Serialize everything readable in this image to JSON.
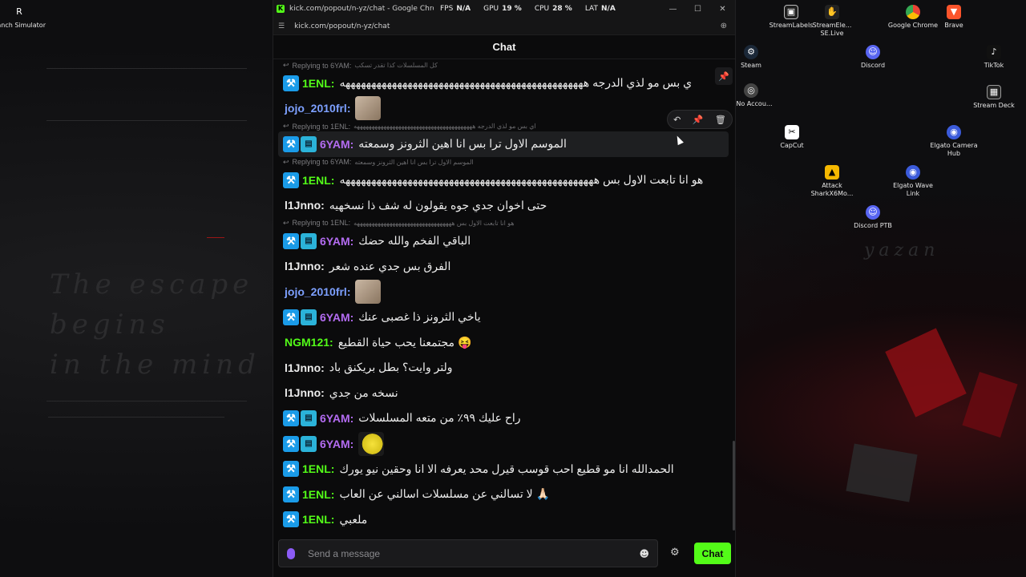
{
  "desktop": {
    "watermark_lines": [
      "The escape",
      "begins",
      "in the mind"
    ],
    "signature": "yazan",
    "icons": [
      {
        "label": "Ranch Simulator",
        "icon": "ranch-icon",
        "color": "#ffffff"
      },
      {
        "label": "StreamLabels",
        "icon": "streamlabels-icon",
        "color": "#ffffff"
      },
      {
        "label": "StreamEle... SE.Live",
        "icon": "streamelements-icon",
        "color": "#ffffff"
      },
      {
        "label": "Google Chrome",
        "icon": "chrome-icon",
        "color": "#4285f4"
      },
      {
        "label": "Brave",
        "icon": "brave-icon",
        "color": "#fb542b"
      },
      {
        "label": "Steam",
        "icon": "steam-icon",
        "color": "#1b2838"
      },
      {
        "label": "Discord",
        "icon": "discord-icon",
        "color": "#5865f2"
      },
      {
        "label": "TikTok",
        "icon": "tiktok-icon",
        "color": "#111111"
      },
      {
        "label": "TcNo Accou...",
        "icon": "tcno-icon",
        "color": "#444444"
      },
      {
        "label": "Stream Deck",
        "icon": "streamdeck-icon",
        "color": "#222222"
      },
      {
        "label": "CapCut",
        "icon": "capcut-icon",
        "color": "#ffffff"
      },
      {
        "label": "Elgato Camera Hub",
        "icon": "elgato-camera-icon",
        "color": "#3b5bdb"
      },
      {
        "label": "Attack SharkX6Mo...",
        "icon": "attackshark-icon",
        "color": "#f5b800"
      },
      {
        "label": "Elgato Wave Link",
        "icon": "elgato-wave-icon",
        "color": "#3b5bdb"
      },
      {
        "label": "Discord PTB",
        "icon": "discord-ptb-icon",
        "color": "#5865f2"
      }
    ]
  },
  "window": {
    "title": "kick.com/popout/n-yz/chat - Google Chrome",
    "url": "kick.com/popout/n-yz/chat",
    "stats": [
      {
        "label": "FPS",
        "value": "N/A"
      },
      {
        "label": "GPU",
        "value": "19 %"
      },
      {
        "label": "CPU",
        "value": "28 %"
      },
      {
        "label": "LAT",
        "value": "N/A"
      }
    ],
    "controls": {
      "minimize": "—",
      "maximize": "☐",
      "close": "✕"
    }
  },
  "chat": {
    "header": "Chat",
    "messages": [
      {
        "reply_to": "Replying to 6YAM:",
        "reply_text": "كل المسلسلات كذا تقدر تسكب"
      },
      {
        "user": "1ENL",
        "user_color": "#53fc18",
        "badges": [
          "mod"
        ],
        "text": "ي بس مو لذي الدرجه هههههههههههههههههههههههههههههههههههههههههههههههه"
      },
      {
        "user": "jojo_2010frl",
        "user_color": "#7da0ff",
        "badges": [],
        "emote": "baby-emote"
      },
      {
        "reply_to": "Replying to 1ENL:",
        "reply_text": "اي بس مو لذي الدرجه ههههههههههههههههههههههههههههههههههههههههه"
      },
      {
        "user": "6YAM",
        "user_color": "#b46cf2",
        "badges": [
          "mod",
          "sub"
        ],
        "text": "الموسم الاول ترا بس انا اهين الثرونز وسمعته",
        "highlight": true
      },
      {
        "reply_to": "Replying to 6YAM:",
        "reply_text": "الموسم الاول ترا بس انا اهين الثرونز وسمعته"
      },
      {
        "user": "1ENL",
        "user_color": "#53fc18",
        "badges": [
          "mod"
        ],
        "text": "هو انا تابعت الاول بس هههههههههههههههههههههههههههههههههههههههههههههههههه"
      },
      {
        "user": "l1Jnno",
        "user_color": "#ececec",
        "badges": [],
        "text": "حتى اخوان جدي جوه يقولون له شف ذا نسخهيه"
      },
      {
        "reply_to": "Replying to 1ENL:",
        "reply_text": "هو انا تابعت الاول بس هههههههههههههههههههههههههههههههههه"
      },
      {
        "user": "6YAM",
        "user_color": "#b46cf2",
        "badges": [
          "mod",
          "sub"
        ],
        "text": "الباقي الفخم والله حضك"
      },
      {
        "user": "l1Jnno",
        "user_color": "#ececec",
        "badges": [],
        "text": "الفرق بس جدي عنده شعر"
      },
      {
        "user": "jojo_2010frl",
        "user_color": "#7da0ff",
        "badges": [],
        "emote": "baby-emote"
      },
      {
        "user": "6YAM",
        "user_color": "#b46cf2",
        "badges": [
          "mod",
          "sub"
        ],
        "text": "ياخي الثرونز ذا غصبى عنك"
      },
      {
        "user": "NGM121",
        "user_color": "#53fc18",
        "badges": [],
        "text": "مجتمعنا يحب حياة القطيع",
        "emoji": "😝"
      },
      {
        "user": "l1Jnno",
        "user_color": "#ececec",
        "badges": [],
        "text": "ولتر وايت؟ بطل بريكنق باد"
      },
      {
        "user": "l1Jnno",
        "user_color": "#ececec",
        "badges": [],
        "text": "نسخه من جدي"
      },
      {
        "user": "6YAM",
        "user_color": "#b46cf2",
        "badges": [
          "mod",
          "sub"
        ],
        "text": "راح عليك ٩٩٪ من متعه المسلسلات"
      },
      {
        "user": "6YAM",
        "user_color": "#b46cf2",
        "badges": [
          "mod",
          "sub"
        ],
        "emote": "yellow-emote"
      },
      {
        "user": "1ENL",
        "user_color": "#53fc18",
        "badges": [
          "mod"
        ],
        "text": "الحمدالله انا مو قطيع احب قوسب قيرل محد يعرفه الا انا وحقين نيو يورك"
      },
      {
        "user": "1ENL",
        "user_color": "#53fc18",
        "badges": [
          "mod"
        ],
        "text": "لا تسالني عن مسلسلات اسالني عن العاب",
        "emoji": "🙏🏻"
      },
      {
        "user": "1ENL",
        "user_color": "#53fc18",
        "badges": [
          "mod"
        ],
        "text": "ملعبي"
      }
    ],
    "composer": {
      "placeholder": "Send a message",
      "send_label": "Chat"
    },
    "accent": "#53fc18"
  }
}
